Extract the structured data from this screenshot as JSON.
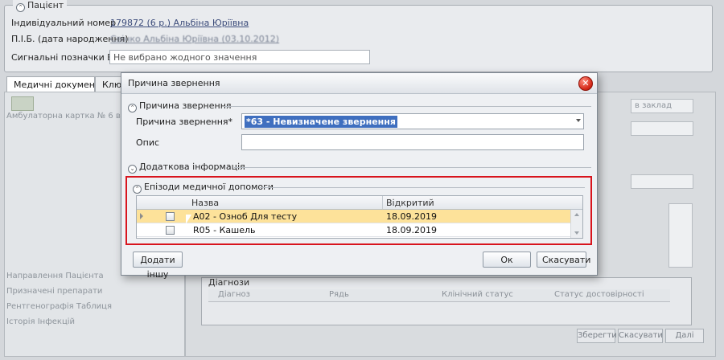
{
  "patient": {
    "group_title": "Пацієнт",
    "id_label": "Індивідуальний номер",
    "id_value": "179872 (6 р.) Альбіна Юріївна",
    "name_label": "П.І.Б. (дата народження)",
    "name_value": "Свінко Альбіна Юріївна (03.10.2012)",
    "emk_label": "Сигнальні позначки ЕМК",
    "emk_value": "Не вибрано жодного значення"
  },
  "tabs": [
    "Медичні документи",
    "Ключ"
  ],
  "background": {
    "left_items": [
      "Амбулаторна картка № 6 від 07.08.",
      "Направлення Пацієнта",
      "Призначені препарати",
      "Рентгенографія Таблиця",
      "Історія Інфекцій"
    ],
    "right_field": "в заклад",
    "diagnoses_title": "Діагнози",
    "diag_columns": [
      "Діагноз",
      "Рядь",
      "Клінічний статус",
      "Статус достовірності"
    ],
    "buttons": [
      "Зберегти",
      "Скасувати",
      "Далі"
    ]
  },
  "dialog": {
    "title": "Причина звернення",
    "section_reason": "Причина звернення",
    "reason_label": "Причина звернення*",
    "reason_value": "*63 - Невизначене звернення",
    "description_label": "Опис",
    "description_value": "",
    "section_additional": "Додаткова інформація",
    "section_episodes": "Епізоди медичної допомоги",
    "grid": {
      "columns": [
        "Назва",
        "Відкритий"
      ],
      "rows": [
        {
          "name": "A02 - Озноб Для тесту",
          "opened": "18.09.2019",
          "checked": false
        },
        {
          "name": "R05 - Кашель",
          "opened": "18.09.2019",
          "checked": false
        }
      ]
    },
    "btn_add_other": "Додати іншу",
    "btn_ok": "Ок",
    "btn_cancel": "Скасувати"
  }
}
